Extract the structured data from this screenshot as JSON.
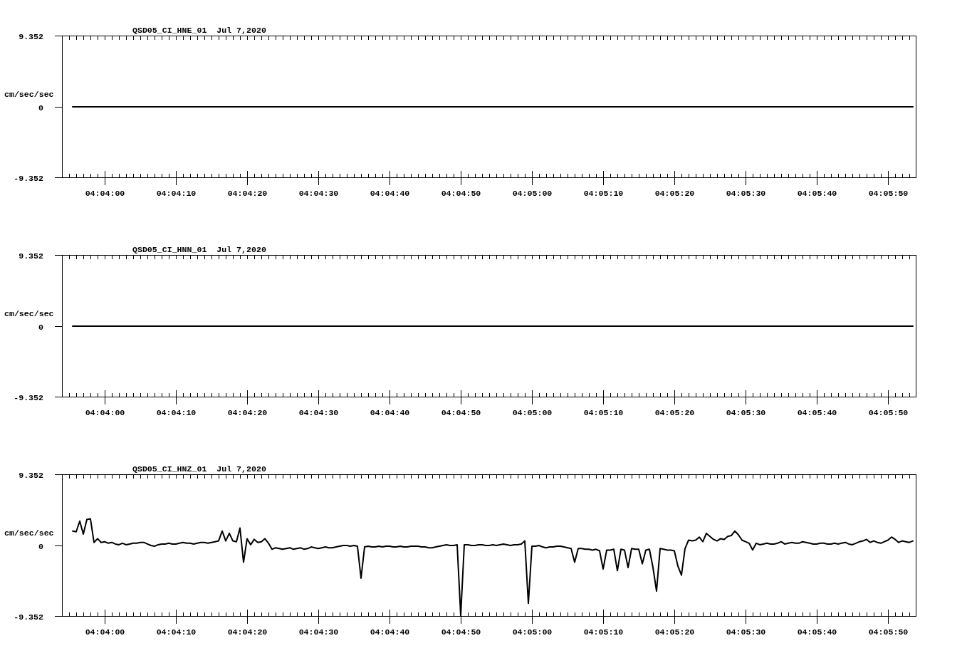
{
  "panels": [
    {
      "chart_data": {
        "type": "line",
        "title": "QSD05_CI_HNE_01  Jul 7,2020",
        "ylabel": "cm/sec/sec",
        "categories": [
          null,
          null,
          null,
          null,
          null,
          null,
          null,
          null,
          null,
          null,
          null,
          null,
          "04:04:00",
          null,
          null,
          null,
          null,
          null,
          null,
          null,
          null,
          null,
          null,
          null,
          null,
          null,
          null,
          null,
          null,
          null,
          null,
          null,
          "04:04:10",
          null,
          null,
          null,
          null,
          null,
          null,
          null,
          null,
          null,
          null,
          null,
          null,
          null,
          null,
          null,
          null,
          null,
          null,
          null,
          "04:04:20",
          null,
          null,
          null,
          null,
          null,
          null,
          null,
          null,
          null,
          null,
          null,
          null,
          null,
          null,
          null,
          null,
          null,
          null,
          null,
          "04:04:30",
          null,
          null,
          null,
          null,
          null,
          null,
          null,
          null,
          null,
          null,
          null,
          null,
          null,
          null,
          null,
          null,
          null,
          null,
          null,
          "04:04:40",
          null,
          null,
          null,
          null,
          null,
          null,
          null,
          null,
          null,
          null,
          null,
          null,
          null,
          null,
          null,
          null,
          null,
          null,
          null,
          "04:04:50",
          null,
          null,
          null,
          null,
          null,
          null,
          null,
          null,
          null,
          null,
          null,
          null,
          null,
          null,
          null,
          null,
          null,
          null,
          null,
          "04:05:00",
          null,
          null,
          null,
          null,
          null,
          null,
          null,
          null,
          null,
          null,
          null,
          null,
          null,
          null,
          null,
          null,
          null,
          null,
          null,
          "04:05:10",
          null,
          null,
          null,
          null,
          null,
          null,
          null,
          null,
          null,
          null,
          null,
          null,
          null,
          null,
          null,
          null,
          null,
          null,
          null,
          "04:05:20",
          null,
          null,
          null,
          null,
          null,
          null,
          null,
          null,
          null,
          null,
          null,
          null,
          null,
          null,
          null,
          null,
          null,
          null,
          null,
          "04:05:30",
          null,
          null,
          null,
          null,
          null,
          null,
          null,
          null,
          null,
          null,
          null,
          null,
          null,
          null,
          null,
          null,
          null,
          null,
          null,
          "04:05:40",
          null,
          null,
          null,
          null,
          null,
          null,
          null,
          null,
          null,
          null,
          null,
          null,
          null,
          null,
          null,
          null,
          null,
          null,
          null,
          "04:05:50",
          null,
          null,
          null,
          null,
          null,
          null,
          null
        ],
        "values": [
          null,
          null,
          null,
          0,
          0,
          0,
          0,
          0,
          0,
          0,
          0,
          0,
          0,
          0,
          0,
          0,
          0,
          0,
          0,
          0,
          0,
          0,
          0,
          0,
          0,
          0,
          0,
          0,
          0,
          0,
          0,
          0,
          0,
          0,
          0,
          0,
          0,
          0,
          0,
          0,
          0,
          0,
          0,
          0,
          0,
          0,
          0,
          0,
          0,
          0,
          0,
          0,
          0,
          0,
          0,
          0,
          0,
          0,
          0,
          0,
          0,
          0,
          0,
          0,
          0,
          0,
          0,
          0,
          0,
          0,
          0,
          0,
          0,
          0,
          0,
          0,
          0,
          0,
          0,
          0,
          0,
          0,
          0,
          0,
          0,
          0,
          0,
          0,
          0,
          0,
          0,
          0,
          0,
          0,
          0,
          0,
          0,
          0,
          0,
          0,
          0,
          0,
          0,
          0,
          0,
          0,
          0,
          0,
          0,
          0,
          0,
          0,
          0,
          0,
          0,
          0,
          0,
          0,
          0,
          0,
          0,
          0,
          0,
          0,
          0,
          0,
          0,
          0,
          0,
          0,
          0,
          0,
          0,
          0,
          0,
          0,
          0,
          0,
          0,
          0,
          0,
          0,
          0,
          0,
          0,
          0,
          0,
          0,
          0,
          0,
          0,
          0,
          0,
          0,
          0,
          0,
          0,
          0,
          0,
          0,
          0,
          0,
          0,
          0,
          0,
          0,
          0,
          0,
          0,
          0,
          0,
          0,
          0,
          0,
          0,
          0,
          0,
          0,
          0,
          0,
          0,
          0,
          0,
          0,
          0,
          0,
          0,
          0,
          0,
          0,
          0,
          0,
          0,
          0,
          0,
          0,
          0,
          0,
          0,
          0,
          0,
          0,
          0,
          0,
          0,
          0,
          0,
          0,
          0,
          0,
          0,
          0,
          0,
          0,
          0,
          0,
          0,
          0,
          0,
          0,
          0,
          0,
          0,
          0,
          0,
          0,
          0,
          0,
          0,
          0,
          0,
          0,
          0,
          0,
          0,
          0,
          0,
          0,
          0,
          0
        ],
        "ylim": [
          -9.352,
          9.352
        ],
        "yticks": [
          -9.352,
          0,
          9.352
        ]
      }
    },
    {
      "chart_data": {
        "type": "line",
        "title": "QSD05_CI_HNN_01  Jul 7,2020",
        "ylabel": "cm/sec/sec",
        "categories": [
          null,
          null,
          null,
          null,
          null,
          null,
          null,
          null,
          null,
          null,
          null,
          null,
          "04:04:00",
          null,
          null,
          null,
          null,
          null,
          null,
          null,
          null,
          null,
          null,
          null,
          null,
          null,
          null,
          null,
          null,
          null,
          null,
          null,
          "04:04:10",
          null,
          null,
          null,
          null,
          null,
          null,
          null,
          null,
          null,
          null,
          null,
          null,
          null,
          null,
          null,
          null,
          null,
          null,
          null,
          "04:04:20",
          null,
          null,
          null,
          null,
          null,
          null,
          null,
          null,
          null,
          null,
          null,
          null,
          null,
          null,
          null,
          null,
          null,
          null,
          null,
          "04:04:30",
          null,
          null,
          null,
          null,
          null,
          null,
          null,
          null,
          null,
          null,
          null,
          null,
          null,
          null,
          null,
          null,
          null,
          null,
          null,
          "04:04:40",
          null,
          null,
          null,
          null,
          null,
          null,
          null,
          null,
          null,
          null,
          null,
          null,
          null,
          null,
          null,
          null,
          null,
          null,
          null,
          "04:04:50",
          null,
          null,
          null,
          null,
          null,
          null,
          null,
          null,
          null,
          null,
          null,
          null,
          null,
          null,
          null,
          null,
          null,
          null,
          null,
          "04:05:00",
          null,
          null,
          null,
          null,
          null,
          null,
          null,
          null,
          null,
          null,
          null,
          null,
          null,
          null,
          null,
          null,
          null,
          null,
          null,
          "04:05:10",
          null,
          null,
          null,
          null,
          null,
          null,
          null,
          null,
          null,
          null,
          null,
          null,
          null,
          null,
          null,
          null,
          null,
          null,
          null,
          "04:05:20",
          null,
          null,
          null,
          null,
          null,
          null,
          null,
          null,
          null,
          null,
          null,
          null,
          null,
          null,
          null,
          null,
          null,
          null,
          null,
          "04:05:30",
          null,
          null,
          null,
          null,
          null,
          null,
          null,
          null,
          null,
          null,
          null,
          null,
          null,
          null,
          null,
          null,
          null,
          null,
          null,
          "04:05:40",
          null,
          null,
          null,
          null,
          null,
          null,
          null,
          null,
          null,
          null,
          null,
          null,
          null,
          null,
          null,
          null,
          null,
          null,
          null,
          "04:05:50",
          null,
          null,
          null,
          null,
          null,
          null,
          null
        ],
        "values": [
          null,
          null,
          null,
          0,
          0,
          0,
          0,
          0,
          0,
          0,
          0,
          0,
          0,
          0,
          0,
          0,
          0,
          0,
          0,
          0,
          0,
          0,
          0,
          0,
          0,
          0,
          0,
          0,
          0,
          0,
          0,
          0,
          0,
          0,
          0,
          0,
          0,
          0,
          0,
          0,
          0,
          0,
          0,
          0,
          0,
          0,
          0,
          0,
          0,
          0,
          0,
          0,
          0,
          0,
          0,
          0,
          0,
          0,
          0,
          0,
          0,
          0,
          0,
          0,
          0,
          0,
          0,
          0,
          0,
          0,
          0,
          0,
          0,
          0,
          0,
          0,
          0,
          0,
          0,
          0,
          0,
          0,
          0,
          0,
          0,
          0,
          0,
          0,
          0,
          0,
          0,
          0,
          0,
          0,
          0,
          0,
          0,
          0,
          0,
          0,
          0,
          0,
          0,
          0,
          0,
          0,
          0,
          0,
          0,
          0,
          0,
          0,
          0,
          0,
          0,
          0,
          0,
          0,
          0,
          0,
          0,
          0,
          0,
          0,
          0,
          0,
          0,
          0,
          0,
          0,
          0,
          0,
          0,
          0,
          0,
          0,
          0,
          0,
          0,
          0,
          0,
          0,
          0,
          0,
          0,
          0,
          0,
          0,
          0,
          0,
          0,
          0,
          0,
          0,
          0,
          0,
          0,
          0,
          0,
          0,
          0,
          0,
          0,
          0,
          0,
          0,
          0,
          0,
          0,
          0,
          0,
          0,
          0,
          0,
          0,
          0,
          0,
          0,
          0,
          0,
          0,
          0,
          0,
          0,
          0,
          0,
          0,
          0,
          0,
          0,
          0,
          0,
          0,
          0,
          0,
          0,
          0,
          0,
          0,
          0,
          0,
          0,
          0,
          0,
          0,
          0,
          0,
          0,
          0,
          0,
          0,
          0,
          0,
          0,
          0,
          0,
          0,
          0,
          0,
          0,
          0,
          0,
          0,
          0,
          0,
          0,
          0,
          0,
          0,
          0,
          0,
          0,
          0,
          0,
          0,
          0,
          0,
          0,
          0,
          0
        ],
        "ylim": [
          -9.352,
          9.352
        ],
        "yticks": [
          -9.352,
          0,
          9.352
        ]
      }
    },
    {
      "chart_data": {
        "type": "line",
        "title": "QSD05_CI_HNZ_01  Jul 7,2020",
        "ylabel": "cm/sec/sec",
        "categories": [
          null,
          null,
          null,
          null,
          null,
          null,
          null,
          null,
          null,
          null,
          null,
          null,
          "04:04:00",
          null,
          null,
          null,
          null,
          null,
          null,
          null,
          null,
          null,
          null,
          null,
          null,
          null,
          null,
          null,
          null,
          null,
          null,
          null,
          "04:04:10",
          null,
          null,
          null,
          null,
          null,
          null,
          null,
          null,
          null,
          null,
          null,
          null,
          null,
          null,
          null,
          null,
          null,
          null,
          null,
          "04:04:20",
          null,
          null,
          null,
          null,
          null,
          null,
          null,
          null,
          null,
          null,
          null,
          null,
          null,
          null,
          null,
          null,
          null,
          null,
          null,
          "04:04:30",
          null,
          null,
          null,
          null,
          null,
          null,
          null,
          null,
          null,
          null,
          null,
          null,
          null,
          null,
          null,
          null,
          null,
          null,
          null,
          "04:04:40",
          null,
          null,
          null,
          null,
          null,
          null,
          null,
          null,
          null,
          null,
          null,
          null,
          null,
          null,
          null,
          null,
          null,
          null,
          null,
          "04:04:50",
          null,
          null,
          null,
          null,
          null,
          null,
          null,
          null,
          null,
          null,
          null,
          null,
          null,
          null,
          null,
          null,
          null,
          null,
          null,
          "04:05:00",
          null,
          null,
          null,
          null,
          null,
          null,
          null,
          null,
          null,
          null,
          null,
          null,
          null,
          null,
          null,
          null,
          null,
          null,
          null,
          "04:05:10",
          null,
          null,
          null,
          null,
          null,
          null,
          null,
          null,
          null,
          null,
          null,
          null,
          null,
          null,
          null,
          null,
          null,
          null,
          null,
          "04:05:20",
          null,
          null,
          null,
          null,
          null,
          null,
          null,
          null,
          null,
          null,
          null,
          null,
          null,
          null,
          null,
          null,
          null,
          null,
          null,
          "04:05:30",
          null,
          null,
          null,
          null,
          null,
          null,
          null,
          null,
          null,
          null,
          null,
          null,
          null,
          null,
          null,
          null,
          null,
          null,
          null,
          "04:05:40",
          null,
          null,
          null,
          null,
          null,
          null,
          null,
          null,
          null,
          null,
          null,
          null,
          null,
          null,
          null,
          null,
          null,
          null,
          null,
          "04:05:50",
          null,
          null,
          null,
          null,
          null,
          null,
          null
        ],
        "values": [
          null,
          null,
          null,
          1.9,
          1.8,
          3.2,
          1.5,
          3.4,
          3.5,
          0.4,
          0.9,
          0.4,
          0.5,
          0.3,
          0.4,
          0.2,
          0.1,
          0.3,
          0.1,
          0.2,
          0.3,
          0.3,
          0.4,
          0.4,
          0.2,
          0.0,
          -0.1,
          0.1,
          0.2,
          0.2,
          0.3,
          0.2,
          0.2,
          0.3,
          0.4,
          0.3,
          0.3,
          0.2,
          0.3,
          0.4,
          0.4,
          0.3,
          0.4,
          0.5,
          0.6,
          1.9,
          0.6,
          1.6,
          0.6,
          0.5,
          2.3,
          -2.2,
          0.9,
          0.1,
          0.8,
          0.4,
          0.5,
          0.9,
          0.3,
          -0.5,
          -0.3,
          -0.4,
          -0.5,
          -0.4,
          -0.3,
          -0.5,
          -0.4,
          -0.3,
          -0.5,
          -0.4,
          -0.2,
          -0.3,
          -0.4,
          -0.3,
          -0.2,
          -0.3,
          -0.3,
          -0.2,
          -0.1,
          0.0,
          0.0,
          -0.1,
          0.0,
          -0.1,
          -4.3,
          -0.2,
          -0.1,
          -0.2,
          -0.2,
          -0.1,
          -0.2,
          -0.1,
          -0.1,
          -0.2,
          -0.2,
          -0.1,
          -0.2,
          -0.2,
          -0.1,
          -0.1,
          -0.1,
          -0.2,
          -0.2,
          -0.3,
          -0.3,
          -0.2,
          -0.1,
          0.0,
          0.1,
          0.0,
          0.0,
          0.1,
          -9.2,
          0.1,
          0.1,
          0.0,
          0.0,
          0.1,
          0.1,
          0.0,
          0.0,
          0.1,
          0.0,
          0.1,
          0.2,
          0.1,
          0.0,
          0.1,
          0.1,
          0.2,
          0.6,
          -7.6,
          -0.1,
          -0.1,
          0.0,
          -0.2,
          -0.3,
          -0.2,
          -0.2,
          -0.1,
          -0.1,
          -0.2,
          -0.3,
          -0.4,
          -2.2,
          -0.4,
          -0.4,
          -0.5,
          -0.5,
          -0.6,
          -0.5,
          -0.7,
          -3.1,
          -0.6,
          -0.6,
          -0.5,
          -3.3,
          -0.5,
          -0.6,
          -2.9,
          -0.4,
          -0.5,
          -0.5,
          -2.4,
          -0.6,
          -0.5,
          -2.9,
          -6.0,
          -0.4,
          -0.5,
          -0.6,
          -0.6,
          -0.7,
          -2.7,
          -3.9,
          -0.4,
          0.7,
          0.6,
          0.7,
          1.1,
          0.5,
          1.6,
          1.2,
          0.8,
          0.6,
          0.9,
          0.8,
          1.2,
          1.3,
          1.9,
          1.4,
          0.7,
          0.5,
          0.3,
          -0.6,
          0.3,
          0.1,
          0.2,
          0.3,
          0.2,
          0.2,
          0.3,
          0.5,
          0.2,
          0.3,
          0.4,
          0.3,
          0.3,
          0.5,
          0.4,
          0.3,
          0.2,
          0.2,
          0.3,
          0.3,
          0.2,
          0.2,
          0.3,
          0.2,
          0.3,
          0.4,
          0.2,
          0.1,
          0.3,
          0.5,
          0.6,
          0.8,
          0.4,
          0.6,
          0.4,
          0.3,
          0.5,
          0.7,
          1.1,
          0.8,
          0.4,
          0.6,
          0.5,
          0.4,
          0.6
        ],
        "ylim": [
          -9.352,
          9.352
        ],
        "yticks": [
          -9.352,
          0,
          9.352
        ]
      }
    }
  ]
}
